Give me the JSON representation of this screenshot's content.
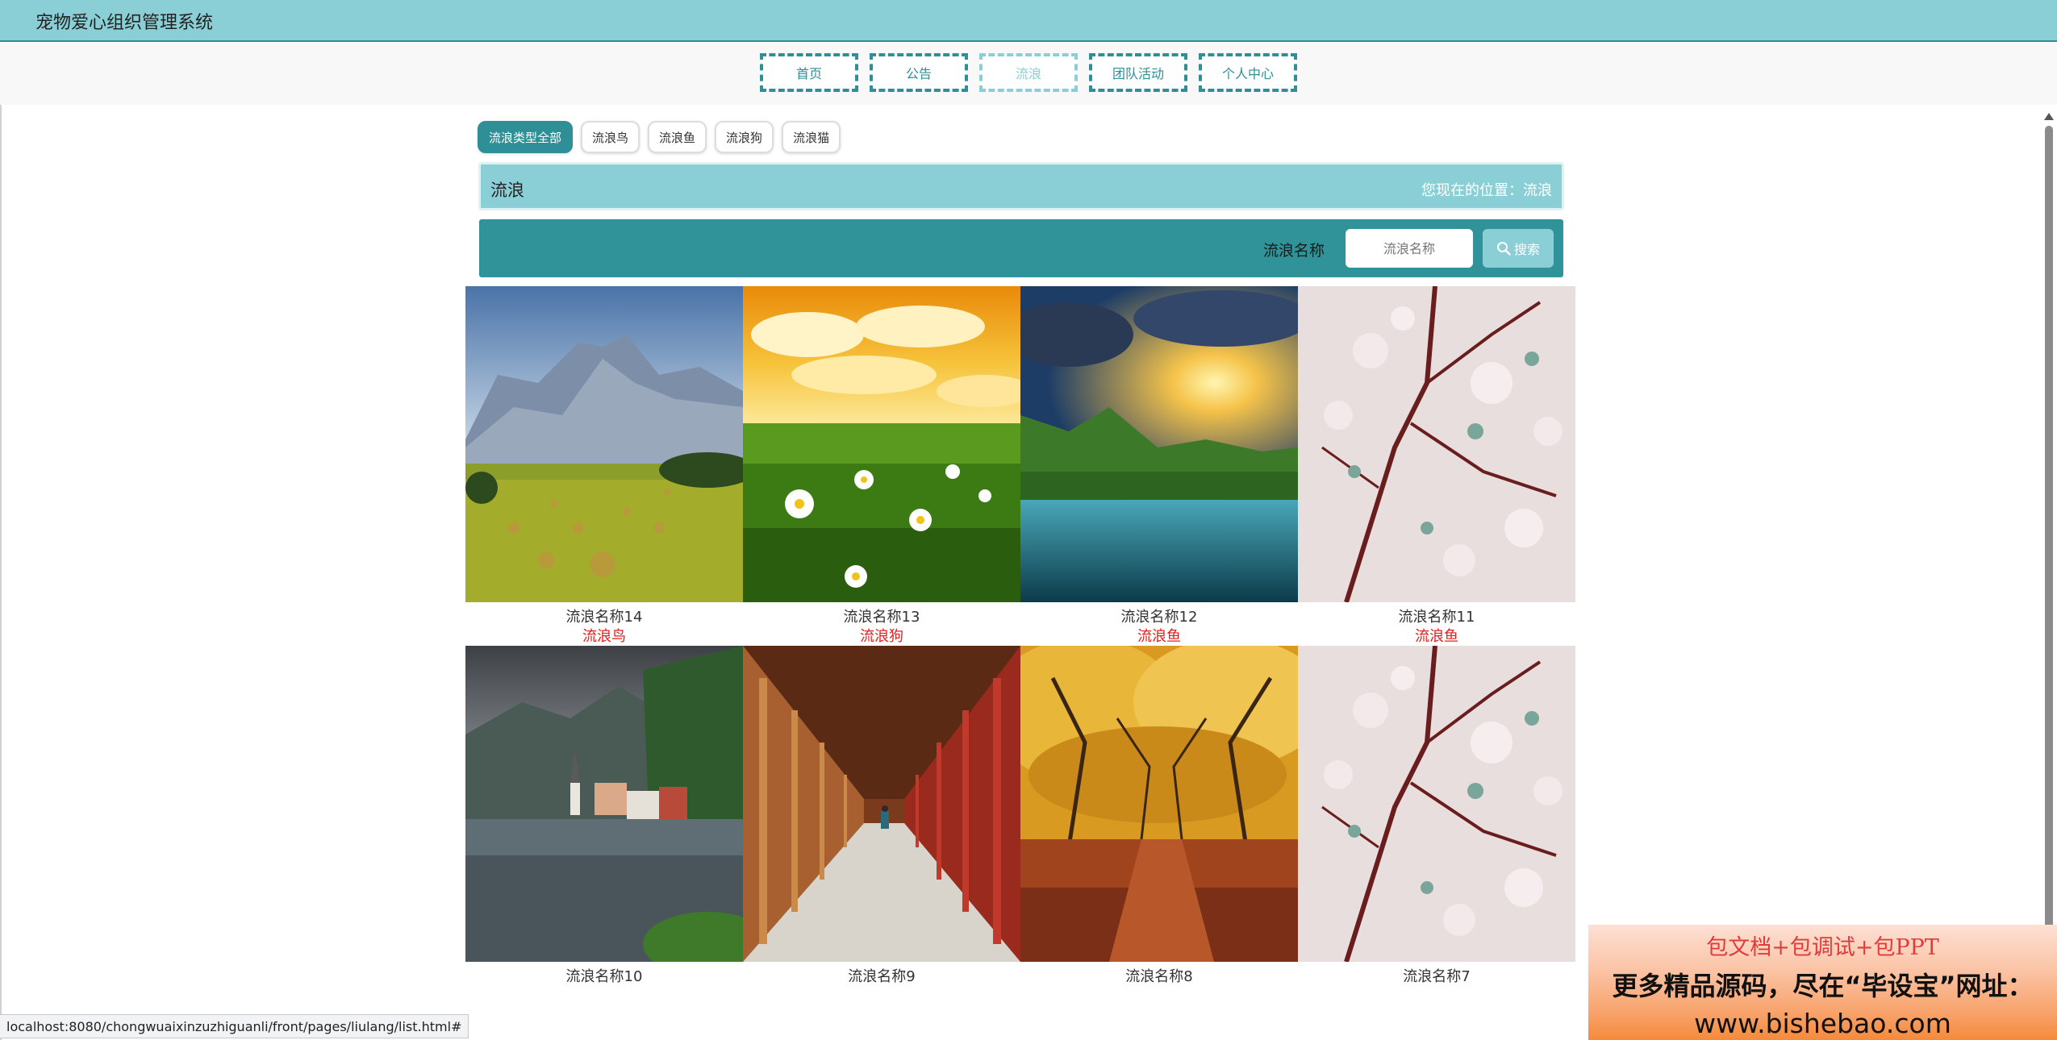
{
  "header": {
    "title": "宠物爱心组织管理系统"
  },
  "nav": {
    "items": [
      {
        "label": "首页"
      },
      {
        "label": "公告"
      },
      {
        "label": "流浪"
      },
      {
        "label": "团队活动"
      },
      {
        "label": "个人中心"
      }
    ],
    "active_index": 2
  },
  "filters": {
    "chips": [
      {
        "label": "流浪类型全部",
        "active": true
      },
      {
        "label": "流浪鸟",
        "active": false
      },
      {
        "label": "流浪鱼",
        "active": false
      },
      {
        "label": "流浪狗",
        "active": false
      },
      {
        "label": "流浪猫",
        "active": false
      }
    ]
  },
  "breadcrumb": {
    "heading": "流浪",
    "location": "您现在的位置：流浪"
  },
  "search": {
    "label": "流浪名称",
    "placeholder": "流浪名称",
    "button_label": "搜索",
    "button_icon": "search-icon"
  },
  "cards": [
    {
      "name": "流浪名称14",
      "type": "流浪鸟",
      "image": "mountain-meadow"
    },
    {
      "name": "流浪名称13",
      "type": "流浪狗",
      "image": "daisy-field"
    },
    {
      "name": "流浪名称12",
      "type": "流浪鱼",
      "image": "lake-sunset"
    },
    {
      "name": "流浪名称11",
      "type": "流浪鱼",
      "image": "cherry-blossom"
    },
    {
      "name": "流浪名称10",
      "type": "",
      "image": "lakeside-village"
    },
    {
      "name": "流浪名称9",
      "type": "",
      "image": "corridor"
    },
    {
      "name": "流浪名称8",
      "type": "",
      "image": "autumn-trees"
    },
    {
      "name": "流浪名称7",
      "type": "",
      "image": "cherry-blossom"
    }
  ],
  "status_url": "localhost:8080/chongwuaixinzuzhiguanli/front/pages/liulang/list.html#",
  "promo": {
    "line1": "包文档+包调试+包PPT",
    "line2": "更多精品源码，尽在“毕设宝”网址：",
    "line3": "www.bishebao.com"
  },
  "colors": {
    "primary": "#2f8f96",
    "light": "#8acfd5",
    "type_text": "#e02020"
  }
}
